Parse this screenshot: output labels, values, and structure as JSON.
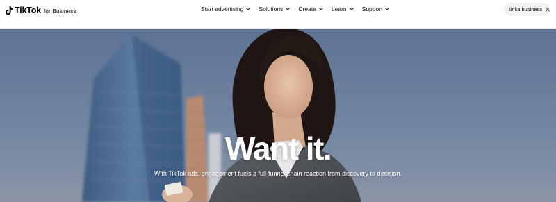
{
  "brand": {
    "name": "TikTok",
    "suffix": "for Business",
    "icon": "tiktok-logo-icon"
  },
  "nav": {
    "items": [
      {
        "label": "Start advertising",
        "icon": "chevron-down-icon"
      },
      {
        "label": "Solutions",
        "icon": "chevron-down-icon"
      },
      {
        "label": "Create",
        "icon": "chevron-down-icon"
      },
      {
        "label": "Learn",
        "icon": "chevron-down-icon"
      },
      {
        "label": "Support",
        "icon": "chevron-down-icon"
      }
    ]
  },
  "account": {
    "label": "linka business",
    "icon": "user-icon"
  },
  "hero": {
    "title": "Want it.",
    "subtitle": "With TikTok ads, engagement fuels a full-funnel chain reaction from discovery to decision."
  },
  "colors": {
    "header_bg": "#ffffff",
    "hero_sky": "#6e82a1",
    "hero_text": "#ffffff",
    "account_bg": "#f1f1f2"
  }
}
